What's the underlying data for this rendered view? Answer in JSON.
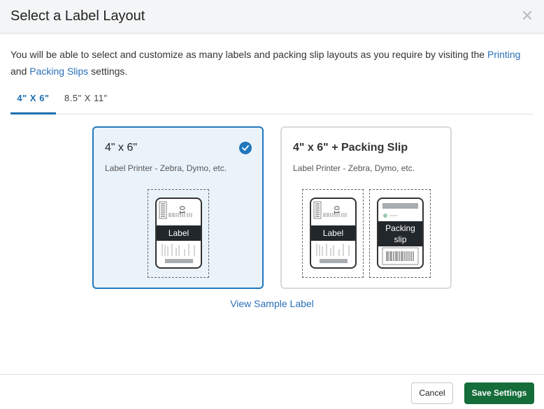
{
  "dialog": {
    "title": "Select a Label Layout",
    "close_icon": "close-icon"
  },
  "intro": {
    "text_before": "You will be able to select and customize as many labels and packing slip layouts as you require by visiting the ",
    "link_printing": "Printing",
    "text_and": " and ",
    "link_packing_slips": "Packing Slips",
    "text_after": " settings."
  },
  "tabs": [
    {
      "label": "4\" X 6\"",
      "active": true
    },
    {
      "label": "8.5\" X 11\"",
      "active": false
    }
  ],
  "cards": [
    {
      "title": "4\" x 6\"",
      "subtitle": "Label Printer - Zebra, Dymo, etc.",
      "selected": true,
      "preview_label": "Label"
    },
    {
      "title": "4\" x 6\" + Packing Slip",
      "subtitle": "Label Printer - Zebra, Dymo, etc.",
      "selected": false,
      "preview_label": "Label",
      "preview_slip_line1": "Packing",
      "preview_slip_line2": "slip"
    }
  ],
  "view_sample": "View Sample Label",
  "footer": {
    "cancel": "Cancel",
    "save": "Save Settings"
  },
  "colors": {
    "accent": "#2177bd",
    "link": "#2a70b8",
    "save_button": "#156d3a",
    "selected_card_bg": "#eaf3fa"
  }
}
